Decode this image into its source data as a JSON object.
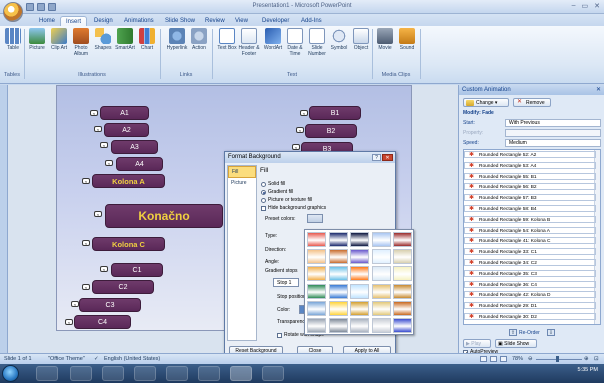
{
  "window": {
    "title": "Presentation1 - Microsoft PowerPoint",
    "min": "–",
    "max": "▭",
    "close": "✕"
  },
  "tabs": [
    "Home",
    "Insert",
    "Design",
    "Animations",
    "Slide Show",
    "Review",
    "View",
    "Developer",
    "Add-Ins"
  ],
  "ribbon": {
    "buttons": [
      "Table",
      "Picture",
      "Clip Art",
      "Photo Album",
      "Shapes",
      "SmartArt",
      "Chart",
      "Hyperlink",
      "Action",
      "Text Box",
      "Header & Footer",
      "WordArt",
      "Date & Time",
      "Slide Number",
      "Symbol",
      "Object",
      "Movie",
      "Sound"
    ],
    "groups": [
      "Tables",
      "Illustrations",
      "Links",
      "Text",
      "Media Clips"
    ]
  },
  "slide": {
    "shapes_left": [
      "A1",
      "A2",
      "A3",
      "A4",
      "Kolona A",
      "Konačno",
      "Kolona C",
      "C1",
      "C2",
      "C3",
      "C4"
    ],
    "shapes_right": [
      "B1",
      "B2",
      "B3"
    ]
  },
  "dialog": {
    "title": "Format Background",
    "help": "?",
    "close": "✕",
    "side": [
      "Fill",
      "Picture"
    ],
    "section": "Fill",
    "options": [
      "Solid fill",
      "Gradient fill",
      "Picture or texture fill",
      "Hide background graphics"
    ],
    "preset_label": "Preset colors:",
    "fields": [
      "Type:",
      "Direction:",
      "Angle:",
      "Gradient stops",
      "Stop position:",
      "Color:",
      "Transparency:"
    ],
    "stop_value": "Stop 1",
    "rotate_label": "Rotate with shape",
    "buttons": [
      "Reset Background",
      "Close",
      "Apply to All"
    ]
  },
  "palette": {
    "colors": [
      [
        "#e85a4f",
        "#1b2a6e",
        "#0d1740",
        "#a9c6f2",
        "#9a2b2b"
      ],
      [
        "#f4c28a",
        "#c96d2e",
        "#6a5acd",
        "#e0f0ff",
        "#d8d0b0"
      ],
      [
        "#f2b04c",
        "#6cc1e8",
        "#ff7a1a",
        "#dbeaf6",
        "#f6f2c2"
      ],
      [
        "#2e8b57",
        "#3a7bd5",
        "#bfe3ff",
        "#e6c070",
        "#c88a30"
      ],
      [
        "#7aa6d8",
        "#ffd43b",
        "#d4a030",
        "#e3c97a",
        "#c96a20"
      ],
      [
        "#9aa4b2",
        "#7f8a99",
        "#aab3c0",
        "#c9ced6",
        "#3a4cd0"
      ]
    ]
  },
  "taskpane": {
    "title": "Custom Animation",
    "close": "✕",
    "change": "Change",
    "remove": "Remove",
    "modify": "Modify: Fade",
    "start_label": "Start:",
    "start_value": "With Previous",
    "property_label": "Property:",
    "speed_label": "Speed:",
    "speed_value": "Medium",
    "items": [
      "Rounded Rectangle 52: A2",
      "Rounded Rectangle 53: A4",
      "Rounded Rectangle 55: B1",
      "Rounded Rectangle 56: B2",
      "Rounded Rectangle 57: B3",
      "Rounded Rectangle 58: B4",
      "Rounded Rectangle 59: Kolona B",
      "Rounded Rectangle 54: Kolona A",
      "Rounded Rectangle 41: Kolona C",
      "Rounded Rectangle 33: C1",
      "Rounded Rectangle 34: C2",
      "Rounded Rectangle 35: C3",
      "Rounded Rectangle 36: C4",
      "Rounded Rectangle 42: Kolona D",
      "Rounded Rectangle 29: D1",
      "Rounded Rectangle 30: D2"
    ],
    "reorder": "Re-Order",
    "play": "Play",
    "slideshow": "Slide Show",
    "autopreview": "AutoPreview"
  },
  "status": {
    "slide": "Slide 1 of 1",
    "theme": "\"Office Theme\"",
    "language": "English (United States)",
    "zoom": "78%"
  },
  "taskbar": {
    "time": "5:35 PM"
  }
}
